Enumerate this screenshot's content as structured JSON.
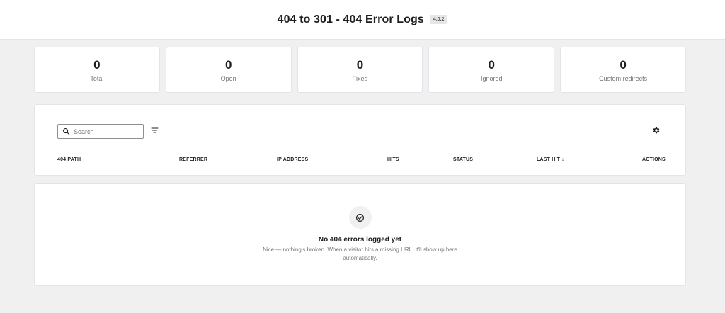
{
  "header": {
    "title": "404 to 301 - 404 Error Logs",
    "version": "4.0.2"
  },
  "stats": [
    {
      "value": "0",
      "label": "Total"
    },
    {
      "value": "0",
      "label": "Open"
    },
    {
      "value": "0",
      "label": "Fixed"
    },
    {
      "value": "0",
      "label": "Ignored"
    },
    {
      "value": "0",
      "label": "Custom redirects"
    }
  ],
  "toolbar": {
    "search_placeholder": "Search"
  },
  "table": {
    "columns": [
      "404 PATH",
      "REFERRER",
      "IP ADDRESS",
      "HITS",
      "STATUS",
      "LAST HIT ↓",
      "ACTIONS"
    ]
  },
  "empty_state": {
    "title": "No 404 errors logged yet",
    "description": "Nice — nothing's broken. When a visitor hits a missing URL, it'll show up here automatically."
  },
  "icons": {
    "search": "search-icon",
    "filter": "filter-icon",
    "settings": "gear-icon",
    "empty": "check-circle-icon"
  },
  "colors": {
    "background": "#f0f0f1",
    "panel": "#ffffff",
    "border": "#e2e4e7",
    "muted": "#757575"
  }
}
